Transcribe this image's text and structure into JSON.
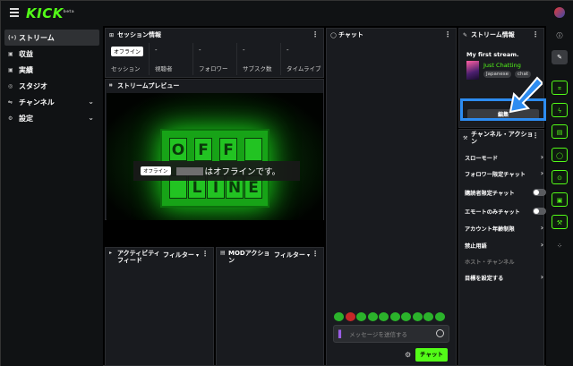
{
  "app": {
    "logo": "KICK",
    "logo_sup": "beta"
  },
  "sidebar": {
    "items": [
      {
        "label": "ストリーム",
        "icon": "broadcast-icon",
        "glyph": "(•)",
        "active": true
      },
      {
        "label": "収益",
        "icon": "money-icon",
        "glyph": "▣"
      },
      {
        "label": "実績",
        "icon": "badge-icon",
        "glyph": "▣"
      },
      {
        "label": "スタジオ",
        "icon": "studio-icon",
        "glyph": "◎"
      },
      {
        "label": "チャンネル",
        "icon": "channel-icon",
        "glyph": "⇋",
        "chevron": "⌄"
      },
      {
        "label": "設定",
        "icon": "gear-icon",
        "glyph": "⚙",
        "chevron": "⌄"
      }
    ]
  },
  "session": {
    "title": "セッション情報",
    "status_badge": "オフライン",
    "columns": [
      {
        "value": "",
        "label": "セッション"
      },
      {
        "value": "-",
        "label": "視聴者"
      },
      {
        "value": "-",
        "label": "フォロワー"
      },
      {
        "value": "-",
        "label": "サブスク数"
      },
      {
        "value": "-",
        "label": "タイムライブ"
      }
    ]
  },
  "preview": {
    "title": "ストリームプレビュー",
    "sign_row1": [
      "O",
      "F",
      "F",
      ""
    ],
    "sign_row2": [
      "",
      "L",
      "I",
      "N",
      "E"
    ],
    "overlay_badge": "オフライン",
    "overlay_text": "はオフラインです。"
  },
  "activity": {
    "title": "アクティビティフィード",
    "filter": "フィルター"
  },
  "mod": {
    "title": "MODアクション",
    "filter": "フィルター"
  },
  "chat": {
    "title": "チャット",
    "placeholder": "メッセージを送信する",
    "send": "チャット"
  },
  "stream_info": {
    "title": "ストリーム情報",
    "stream_title": "My first stream.",
    "category": "Just Chatting",
    "tags": [
      "Japanese",
      "chat"
    ],
    "edit": "編集"
  },
  "channel_actions": {
    "title": "チャンネル・アクション",
    "rows": [
      {
        "label": "スローモード",
        "kind": "chevron"
      },
      {
        "label": "フォロワー限定チャット",
        "kind": "chevron"
      },
      {
        "label": "購読者限定チャット",
        "kind": "toggle"
      },
      {
        "label": "エモートのみチャット",
        "kind": "toggle"
      },
      {
        "label": "アカウント年齢制限",
        "kind": "chevron"
      },
      {
        "label": "禁止用語",
        "kind": "chevron"
      },
      {
        "label": "ホスト・チャンネル",
        "kind": "disabled"
      },
      {
        "label": "目標を設定する",
        "kind": "chevron"
      }
    ]
  },
  "colors": {
    "accent": "#53fc18",
    "highlight": "#2d8cf0",
    "panel": "#191b1f"
  }
}
